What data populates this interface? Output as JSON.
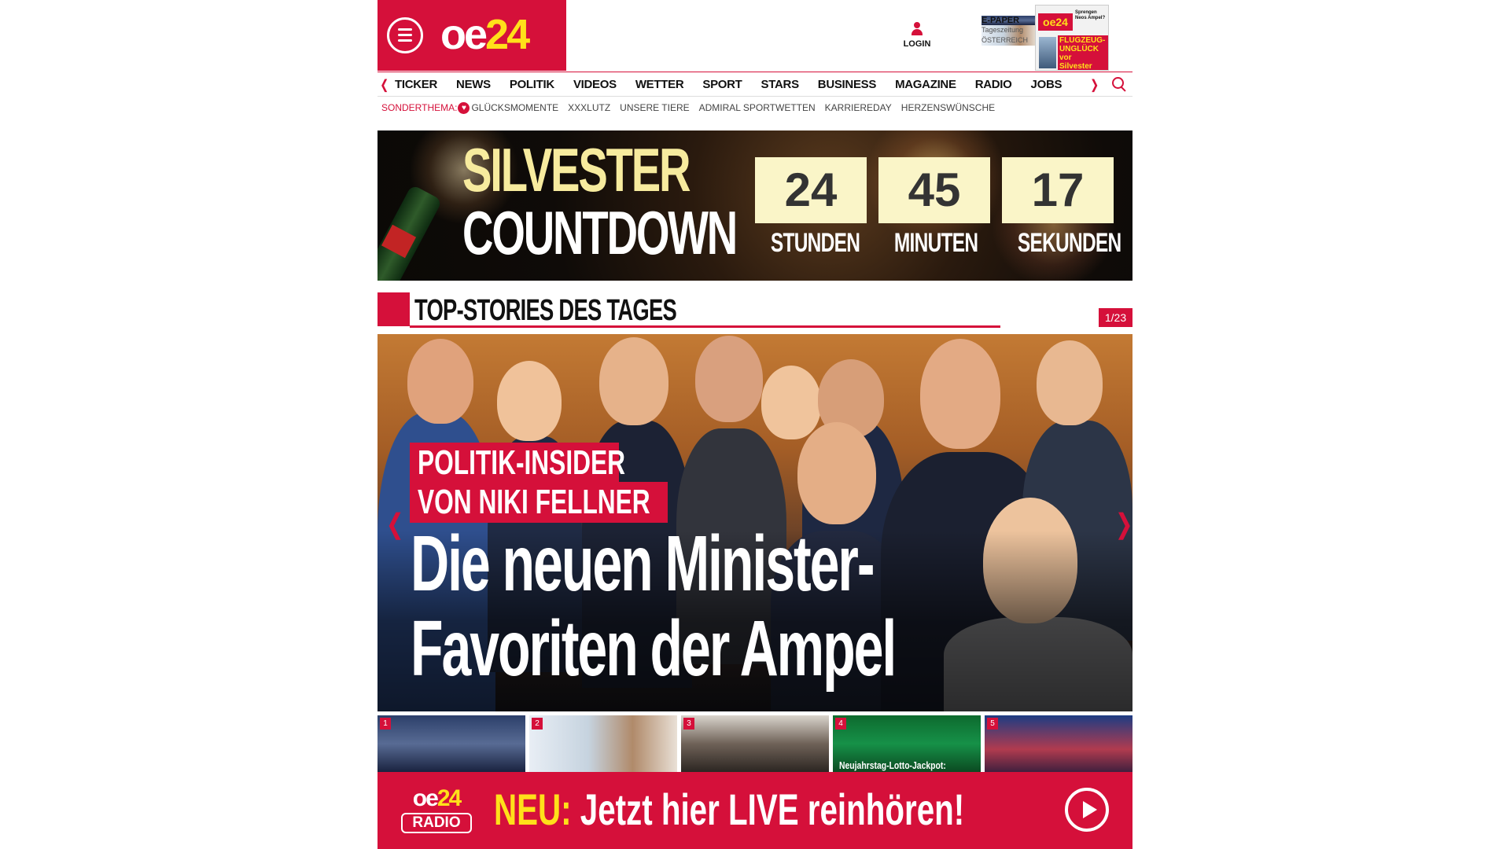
{
  "header": {
    "logo": {
      "oe": "oe",
      "num": "24"
    },
    "login_label": "LOGIN",
    "epaper": {
      "title": "E-PAPER",
      "line1": "Tageszeitung",
      "line2": "ÖSTERREICH",
      "thumb_masthead": "oe24",
      "thumb_headline": "FLUGZEUG-UNGLÜCK vor Silvester",
      "thumb_sub": "Sprengen Neos Ampel?"
    }
  },
  "nav": {
    "prev_arrow": "❬",
    "next_arrow": "❭",
    "items": [
      "TICKER",
      "NEWS",
      "POLITIK",
      "VIDEOS",
      "WETTER",
      "SPORT",
      "STARS",
      "BUSINESS",
      "MAGAZINE",
      "RADIO",
      "JOBS"
    ]
  },
  "subnav": {
    "label": "SONDERTHEMA:",
    "heart": "♥",
    "items": [
      "GLÜCKSMOMENTE",
      "XXXLUTZ",
      "UNSERE TIERE",
      "ADMIRAL SPORTWETTEN",
      "KARRIEREDAY",
      "HERZENSWÜNSCHE"
    ]
  },
  "banner": {
    "title1": "SILVESTER",
    "title2": "COUNTDOWN",
    "countdown": [
      {
        "value": "24",
        "unit": "STUNDEN"
      },
      {
        "value": "45",
        "unit": "MINUTEN"
      },
      {
        "value": "17",
        "unit": "SEKUNDEN"
      }
    ]
  },
  "top_stories": {
    "title": "TOP-STORIES DES TAGES",
    "counter": "1/23",
    "hero": {
      "kicker_line1": "POLITIK-INSIDER",
      "kicker_line2": "VON NIKI FELLNER",
      "headline_line1": "Die neuen Minister-",
      "headline_line2": "Favoriten der Ampel",
      "prev_arrow": "❬",
      "next_arrow": "❭"
    },
    "thumbs": [
      {
        "num": "1",
        "caption": ""
      },
      {
        "num": "2",
        "caption": ""
      },
      {
        "num": "3",
        "caption": ""
      },
      {
        "num": "4",
        "caption": "Neujahrstag-Lotto-Jackpot:"
      },
      {
        "num": "5",
        "caption": ""
      }
    ]
  },
  "radio": {
    "logo_oe": "oe",
    "logo_num": "24",
    "logo_radio": "RADIO",
    "neu": "NEU:",
    "text": " Jetzt hier LIVE reinhören!"
  },
  "colors": {
    "brand_red": "#d5103a",
    "brand_yellow": "#ffe01a",
    "countdown_box": "#faf5c8"
  }
}
